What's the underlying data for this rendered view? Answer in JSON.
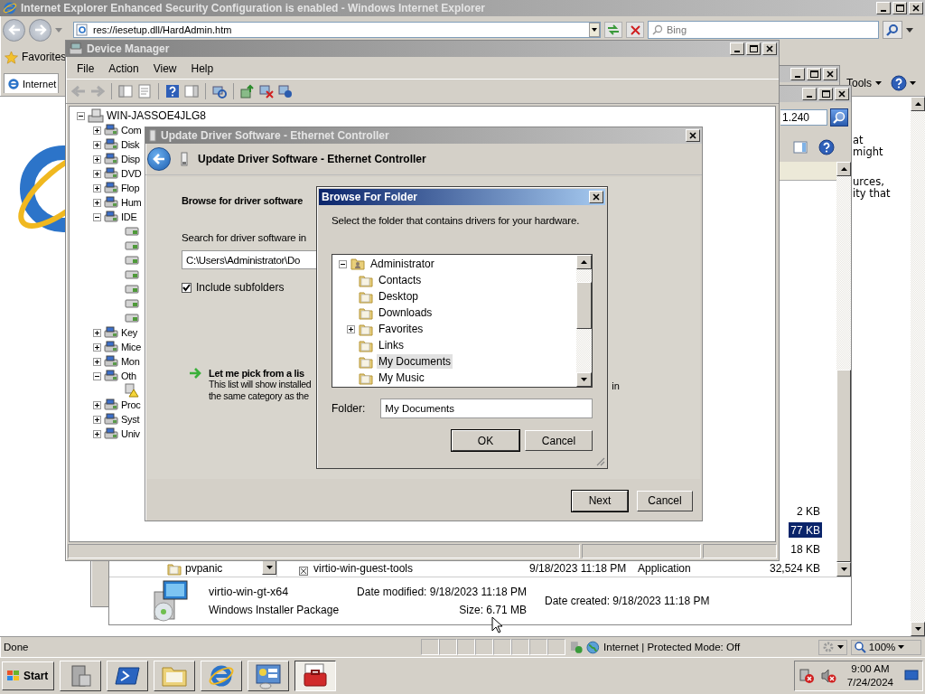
{
  "browser": {
    "title": "Internet Explorer Enhanced Security Configuration is enabled - Windows Internet Explorer",
    "address": "res://iesetup.dll/HardAdmin.htm",
    "search_placeholder": "Bing",
    "favorites": "Favorites",
    "tab": "Internet",
    "tools": "Tools",
    "page_text": [
      "at",
      "might",
      "urces,",
      "ity that"
    ],
    "status": "Done",
    "zone": "Internet | Protected Mode: Off",
    "zoom": "100%"
  },
  "explorer": {
    "address": "1.240",
    "folder": "pvpanic",
    "rows": [
      {
        "size": "2 KB",
        "selected": false
      },
      {
        "size": "77 KB",
        "selected": true
      },
      {
        "size": "18 KB",
        "selected": false
      },
      {
        "name": "virtio-win-guest-tools",
        "date": "9/18/2023 11:18 PM",
        "type": "Application",
        "size": "32,524 KB",
        "selected": false
      }
    ],
    "details": {
      "name": "virtio-win-gt-x64",
      "kind": "Windows Installer Package",
      "modified": "Date modified: 9/18/2023 11:18 PM",
      "created": "Date created: 9/18/2023 11:18 PM",
      "size": "Size: 6.71 MB"
    }
  },
  "device_manager": {
    "title": "Device Manager",
    "menu": [
      "File",
      "Action",
      "View",
      "Help"
    ],
    "tree": {
      "label": "WIN-JASSOE4JLG8",
      "expanded": true,
      "children": [
        {
          "label": "Com",
          "expanded": false
        },
        {
          "label": "Disk",
          "expanded": false
        },
        {
          "label": "Disp",
          "expanded": false
        },
        {
          "label": "DVD",
          "expanded": false
        },
        {
          "label": "Flop",
          "expanded": false
        },
        {
          "label": "Hum",
          "expanded": false
        },
        {
          "label": "IDE",
          "expanded": true,
          "children": [
            {
              "kind": "controller"
            },
            {
              "kind": "controller"
            },
            {
              "kind": "controller"
            },
            {
              "kind": "controller"
            },
            {
              "kind": "controller"
            },
            {
              "kind": "controller"
            },
            {
              "kind": "controller"
            }
          ]
        },
        {
          "label": "Key",
          "expanded": false
        },
        {
          "label": "Mice",
          "expanded": false
        },
        {
          "label": "Mon",
          "expanded": false
        },
        {
          "label": "Oth",
          "expanded": true,
          "children": [
            {
              "kind": "warning"
            }
          ]
        },
        {
          "label": "Proc",
          "expanded": false
        },
        {
          "label": "Syst",
          "expanded": false
        },
        {
          "label": "Univ",
          "expanded": false
        }
      ]
    }
  },
  "update_driver": {
    "title": "Update Driver Software - Ethernet Controller",
    "heading": "Update Driver Software - Ethernet Controller",
    "section": "Browse for driver software",
    "search_label": "Search for driver software in",
    "path": "C:\\Users\\Administrator\\Do",
    "include_subfolders": {
      "label": "Include subfolders",
      "checked": true
    },
    "pick_title": "Let me pick from a lis",
    "pick_text": [
      "This list will show installed",
      "the same category as the"
    ],
    "pick_tail": "in",
    "buttons": [
      "Next",
      "Cancel"
    ]
  },
  "browse_folder": {
    "title": "Browse For Folder",
    "prompt": "Select the folder that contains drivers for your hardware.",
    "tree": {
      "label": "Administrator",
      "expanded": true,
      "children": [
        {
          "label": "Contacts",
          "expandable": false,
          "selected": false
        },
        {
          "label": "Desktop",
          "expandable": false,
          "selected": false
        },
        {
          "label": "Downloads",
          "expandable": false,
          "selected": false
        },
        {
          "label": "Favorites",
          "expandable": true,
          "selected": false
        },
        {
          "label": "Links",
          "expandable": false,
          "selected": false
        },
        {
          "label": "My Documents",
          "expandable": false,
          "selected": true
        },
        {
          "label": "My Music",
          "expandable": false,
          "selected": false
        }
      ]
    },
    "folder_label": "Folder:",
    "folder_value": "My Documents",
    "buttons": [
      "OK",
      "Cancel"
    ]
  },
  "taskbar": {
    "start": "Start",
    "apps": [
      {
        "kind": "server",
        "active": false
      },
      {
        "kind": "shell",
        "active": false
      },
      {
        "kind": "folder",
        "active": false
      },
      {
        "kind": "browser",
        "active": false
      },
      {
        "kind": "panel",
        "active": false
      },
      {
        "kind": "toolbox",
        "active": true
      }
    ],
    "time": "9:00 AM",
    "date": "7/24/2024"
  }
}
